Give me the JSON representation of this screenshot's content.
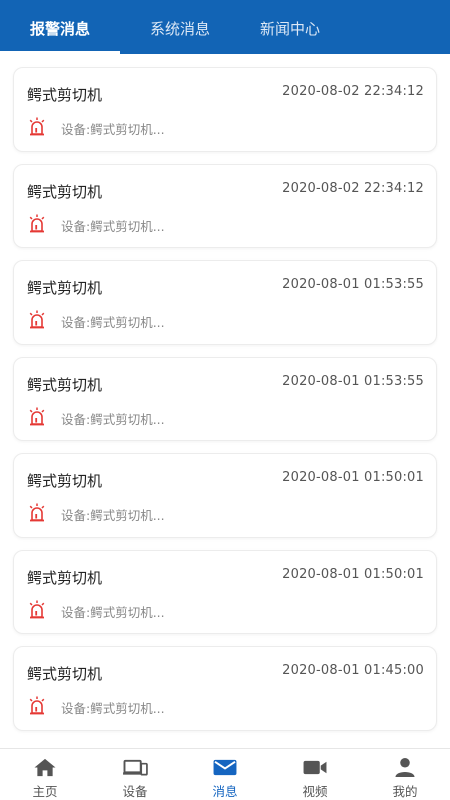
{
  "tabs": [
    {
      "label": "报警消息",
      "active": true
    },
    {
      "label": "系统消息",
      "active": false
    },
    {
      "label": "新闻中心",
      "active": false
    }
  ],
  "messages": [
    {
      "title": "鳄式剪切机",
      "time": "2020-08-02 22:34:12",
      "device": "设备:鳄式剪切机..."
    },
    {
      "title": "鳄式剪切机",
      "time": "2020-08-02 22:34:12",
      "device": "设备:鳄式剪切机..."
    },
    {
      "title": "鳄式剪切机",
      "time": "2020-08-01 01:53:55",
      "device": "设备:鳄式剪切机..."
    },
    {
      "title": "鳄式剪切机",
      "time": "2020-08-01 01:53:55",
      "device": "设备:鳄式剪切机..."
    },
    {
      "title": "鳄式剪切机",
      "time": "2020-08-01 01:50:01",
      "device": "设备:鳄式剪切机..."
    },
    {
      "title": "鳄式剪切机",
      "time": "2020-08-01 01:50:01",
      "device": "设备:鳄式剪切机..."
    },
    {
      "title": "鳄式剪切机",
      "time": "2020-08-01 01:45:00",
      "device": "设备:鳄式剪切机..."
    }
  ],
  "bottom_nav": [
    {
      "label": "主页",
      "icon": "home-icon",
      "active": false
    },
    {
      "label": "设备",
      "icon": "devices-icon",
      "active": false
    },
    {
      "label": "消息",
      "icon": "mail-icon",
      "active": true
    },
    {
      "label": "视频",
      "icon": "video-icon",
      "active": false
    },
    {
      "label": "我的",
      "icon": "person-icon",
      "active": false
    }
  ],
  "colors": {
    "header": "#1264b5",
    "accent": "#1565c0",
    "alarm": "#e53935"
  }
}
